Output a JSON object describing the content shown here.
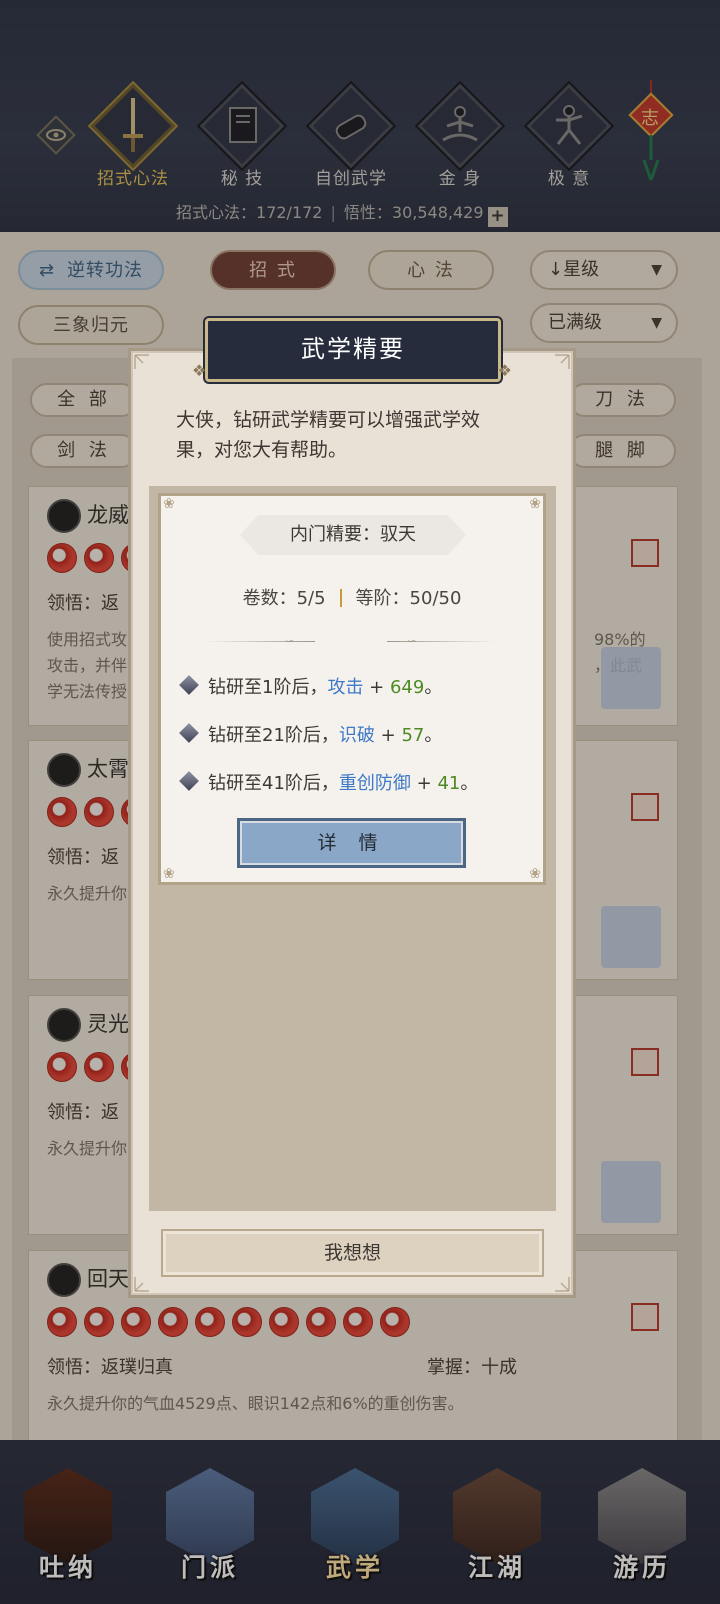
{
  "header": {
    "categories": [
      {
        "label": "招式心法",
        "icon": "sword-icon",
        "active": true
      },
      {
        "label": "秘 技",
        "icon": "book-icon",
        "active": false
      },
      {
        "label": "自创武学",
        "icon": "scroll-icon",
        "active": false
      },
      {
        "label": "金 身",
        "icon": "meditation-icon",
        "active": false
      },
      {
        "label": "极 意",
        "icon": "martial-pose-icon",
        "active": false
      }
    ],
    "knot_char": "志",
    "stats": {
      "skills_label": "招式心法：",
      "skills_value": "172/172",
      "insight_label": "悟性：",
      "insight_value": "30,548,429",
      "plus": "+"
    }
  },
  "toolbar": {
    "reverse": "逆转功法",
    "reverse_icon": "⇄",
    "zhaoshi": "招 式",
    "xinfa": "心 法",
    "sanxiang": "三象归元",
    "sort": "星级",
    "sort_arrow": "↓",
    "filter": "已满级",
    "dropdown_arrow": "▼"
  },
  "filters": {
    "all": "全 部",
    "blade": "刀 法",
    "sword": "剑 法",
    "leg": "腿 脚"
  },
  "cards": [
    {
      "name": "龙威",
      "ling": "领悟：返",
      "desc": "使用招式攻\n攻击，并伴\n学无法传授",
      "desc_right": "98%的\n，此武"
    },
    {
      "name": "太霄",
      "ling": "领悟：返",
      "desc": "永久提升你"
    },
    {
      "name": "灵光",
      "ling": "领悟：返",
      "desc": "永久提升你"
    },
    {
      "name": "回天",
      "ling": "领悟：返璞归真",
      "mastery": "掌握：十成",
      "desc": "永久提升你的气血4529点、眼识142点和6%的重创伤害。"
    }
  ],
  "bottom_nav": [
    {
      "label": "吐纳",
      "active": false
    },
    {
      "label": "门派",
      "active": false
    },
    {
      "label": "武学",
      "active": true
    },
    {
      "label": "江湖",
      "active": false
    },
    {
      "label": "游历",
      "active": false
    }
  ],
  "modal": {
    "title": "武学精要",
    "intro": "大侠，钻研武学精要可以增强武学效果，对您大有帮助。",
    "subtitle": "内门精要：驭天",
    "volumes_label": "卷数：",
    "volumes_value": "5/5",
    "rank_label": "等阶：",
    "rank_value": "50/50",
    "bonuses": [
      {
        "prefix": "钻研至1阶后，",
        "attr": "攻击",
        "plus": " + ",
        "value": "649",
        "suffix": "。"
      },
      {
        "prefix": "钻研至21阶后，",
        "attr": "识破",
        "plus": " + ",
        "value": "57",
        "suffix": "。"
      },
      {
        "prefix": "钻研至41阶后，",
        "attr": "重创防御",
        "plus": " + ",
        "value": "41",
        "suffix": "。"
      }
    ],
    "detail_button": "详 情",
    "cancel_button": "我想想"
  },
  "colors": {
    "attr_blue": "#3e79c7",
    "value_green": "#4d8a21",
    "active_gold": "#e7c35b",
    "header_bg": "#2c3446"
  }
}
